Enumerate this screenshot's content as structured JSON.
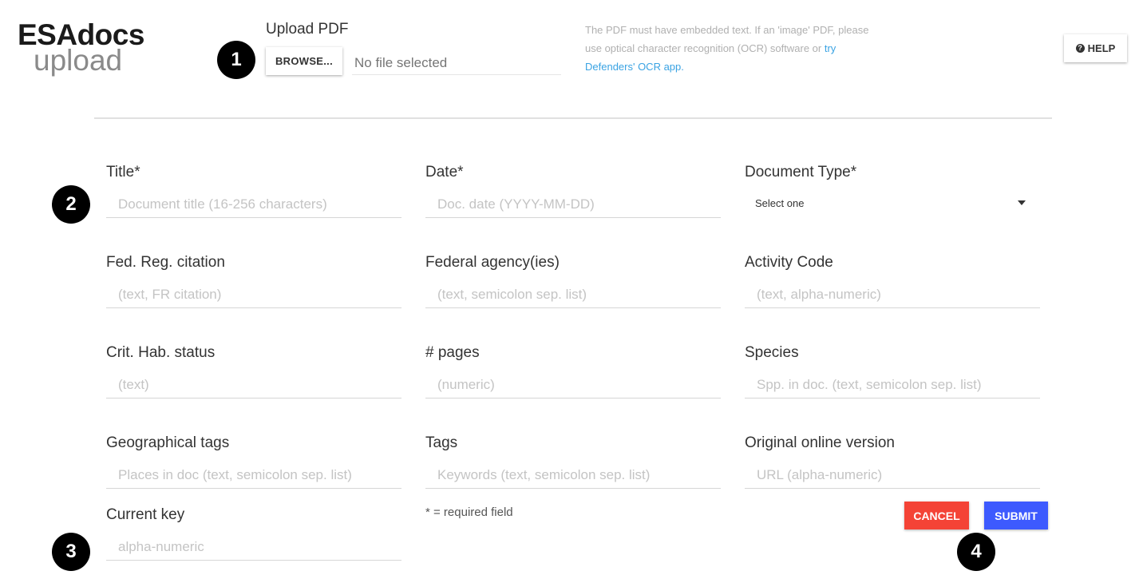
{
  "logo": {
    "top": "ESAdocs",
    "bottom": "upload"
  },
  "upload": {
    "label": "Upload PDF",
    "browse_label": "BROWSE...",
    "file_placeholder": "No file selected",
    "note_text": "The PDF must have embedded text. If an 'image' PDF, please use optical character recognition (OCR) software or ",
    "note_link": "try Defenders' OCR app."
  },
  "help": {
    "icon_glyph": "?",
    "label": "HELP"
  },
  "steps": [
    "1",
    "2",
    "3",
    "4"
  ],
  "form": {
    "title": {
      "label": "Title*",
      "placeholder": "Document title (16-256 characters)"
    },
    "date": {
      "label": "Date*",
      "placeholder": "Doc. date (YYYY-MM-DD)"
    },
    "doc_type": {
      "label": "Document Type*",
      "selected": "Select one"
    },
    "fed_reg": {
      "label": "Fed. Reg. citation",
      "placeholder": "(text, FR citation)"
    },
    "agency": {
      "label": "Federal agency(ies)",
      "placeholder": "(text, semicolon sep. list)"
    },
    "activity": {
      "label": "Activity Code",
      "placeholder": "(text, alpha-numeric)"
    },
    "crit_hab": {
      "label": "Crit. Hab. status",
      "placeholder": "(text)"
    },
    "pages": {
      "label": "# pages",
      "placeholder": "(numeric)"
    },
    "species": {
      "label": "Species",
      "placeholder": "Spp. in doc. (text, semicolon sep. list)"
    },
    "geo": {
      "label": "Geographical tags",
      "placeholder": "Places in doc (text, semicolon sep. list)"
    },
    "tags": {
      "label": "Tags",
      "placeholder": "Keywords (text, semicolon sep. list)"
    },
    "original": {
      "label": "Original online version",
      "placeholder": "URL (alpha-numeric)"
    },
    "key": {
      "label": "Current key",
      "placeholder": "alpha-numeric"
    }
  },
  "required_note": "* = required field",
  "actions": {
    "cancel": "CANCEL",
    "submit": "SUBMIT"
  },
  "colors": {
    "cancel": "#f44336",
    "submit": "#3d5afe",
    "link": "#3aa3e3"
  }
}
